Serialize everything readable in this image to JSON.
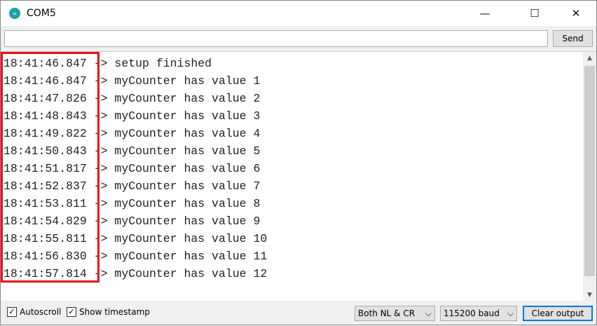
{
  "window": {
    "title": "COM5",
    "minimize": "—",
    "maximize": "☐",
    "close": "✕"
  },
  "input": {
    "value": "",
    "send_label": "Send"
  },
  "output": {
    "lines": [
      {
        "ts": "18:41:46.847",
        "msg": " -> setup finished"
      },
      {
        "ts": "18:41:46.847",
        "msg": " -> myCounter has value 1"
      },
      {
        "ts": "18:41:47.826",
        "msg": " -> myCounter has value 2"
      },
      {
        "ts": "18:41:48.843",
        "msg": " -> myCounter has value 3"
      },
      {
        "ts": "18:41:49.822",
        "msg": " -> myCounter has value 4"
      },
      {
        "ts": "18:41:50.843",
        "msg": " -> myCounter has value 5"
      },
      {
        "ts": "18:41:51.817",
        "msg": " -> myCounter has value 6"
      },
      {
        "ts": "18:41:52.837",
        "msg": " -> myCounter has value 7"
      },
      {
        "ts": "18:41:53.811",
        "msg": " -> myCounter has value 8"
      },
      {
        "ts": "18:41:54.829",
        "msg": " -> myCounter has value 9"
      },
      {
        "ts": "18:41:55.811",
        "msg": " -> myCounter has value 10"
      },
      {
        "ts": "18:41:56.830",
        "msg": " -> myCounter has value 11"
      },
      {
        "ts": "18:41:57.814",
        "msg": " -> myCounter has value 12"
      }
    ]
  },
  "footer": {
    "autoscroll": "Autoscroll",
    "show_timestamp": "Show timestamp",
    "line_ending": "Both NL & CR",
    "baud": "115200 baud",
    "clear": "Clear output",
    "check": "✓",
    "chevron": "⌵"
  },
  "colors": {
    "highlight": "#e8121b",
    "logo": "#17a1a5"
  }
}
